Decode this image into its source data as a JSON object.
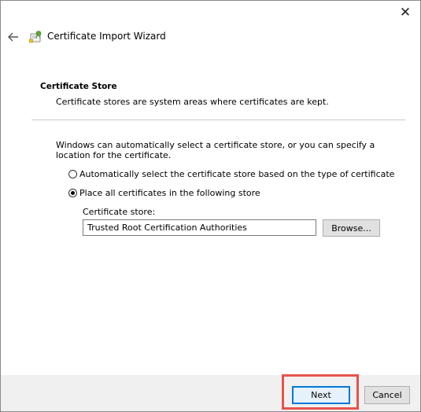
{
  "window": {
    "title": "Certificate Import Wizard",
    "close_icon": "close-icon",
    "back_icon": "back-arrow-icon",
    "wizard_icon": "certificate-icon"
  },
  "section": {
    "title": "Certificate Store",
    "description": "Certificate stores are system areas where certificates are kept."
  },
  "intro": "Windows can automatically select a certificate store, or you can specify a location for the certificate.",
  "options": [
    {
      "label": "Automatically select the certificate store based on the type of certificate",
      "checked": false
    },
    {
      "label": "Place all certificates in the following store",
      "checked": true
    }
  ],
  "store": {
    "label": "Certificate store:",
    "value": "Trusted Root Certification Authorities",
    "browse_label": "Browse..."
  },
  "footer": {
    "next_label": "Next",
    "cancel_label": "Cancel"
  },
  "colors": {
    "highlight": "#e8524c",
    "accent": "#0078d7"
  }
}
